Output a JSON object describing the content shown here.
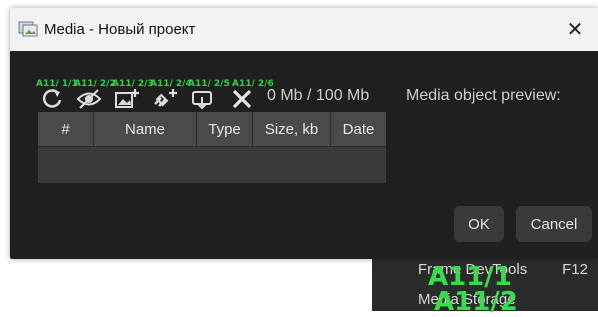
{
  "window": {
    "title": "Media - Новый проект",
    "close_glyph": "✕"
  },
  "toolbar": {
    "buttons": [
      {
        "name": "refresh-icon",
        "overlay": "A11/ 1/1"
      },
      {
        "name": "hide-eye-icon",
        "overlay": "A11/ 2/2"
      },
      {
        "name": "add-image-icon",
        "overlay": "A11/ 2/3"
      },
      {
        "name": "add-link-icon",
        "overlay": "A11/ 2/4"
      },
      {
        "name": "export-icon",
        "overlay": "A11/ 2/5"
      },
      {
        "name": "delete-icon",
        "overlay": "A11/ 2/6"
      }
    ],
    "size_text": "0 Mb / 100 Mb"
  },
  "table": {
    "headers": [
      "#",
      "Name",
      "Type",
      "Size, kb",
      "Date"
    ]
  },
  "preview": {
    "label": "Media object preview:"
  },
  "buttons": {
    "ok": "OK",
    "cancel": "Cancel"
  },
  "context_menu": {
    "items": [
      {
        "label": "Frame DevTools",
        "shortcut": "F12"
      },
      {
        "label": "Media Storage",
        "shortcut": ""
      }
    ],
    "overlays": [
      "A11/1",
      "A11/2"
    ]
  },
  "colors": {
    "window_bg": "#1f1f1f",
    "overlay_green": "#2bd44a"
  }
}
